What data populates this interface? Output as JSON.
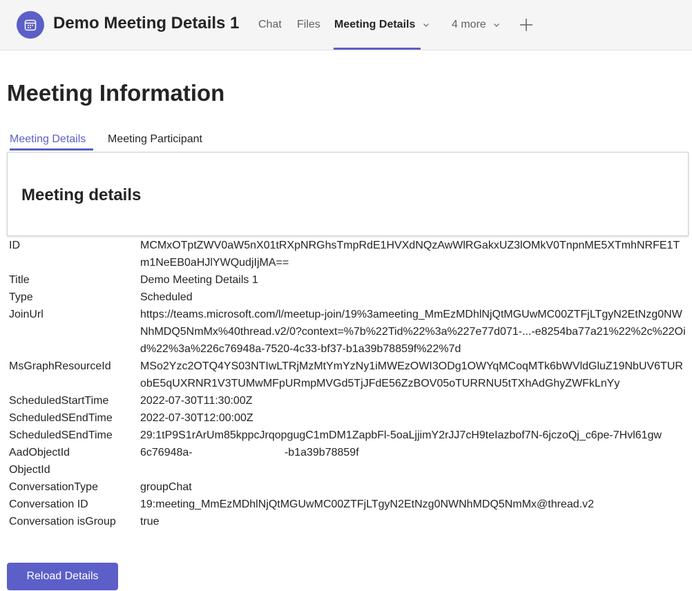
{
  "header": {
    "meeting_title": "Demo Meeting Details 1",
    "tabs": [
      {
        "label": "Chat"
      },
      {
        "label": "Files"
      },
      {
        "label": "Meeting Details"
      },
      {
        "label": "4 more"
      }
    ],
    "accent_color": "#5b5fc7"
  },
  "page": {
    "title": "Meeting Information",
    "subtabs": [
      {
        "label": "Meeting Details"
      },
      {
        "label": "Meeting Participant"
      }
    ],
    "card_title": "Meeting details"
  },
  "details": [
    {
      "label": "ID",
      "value": "MCMxOTptZWV0aW5nX01tRXpNRGhsTmpRdE1HVXdNQzAwWlRGakxUZ3lOMkV0TnpnME5XTmhNRFE1Tm1NeEB0aHJlYWQudjIjMA=="
    },
    {
      "label": "Title",
      "value": "Demo Meeting Details 1"
    },
    {
      "label": "Type",
      "value": "Scheduled"
    },
    {
      "label": "JoinUrl",
      "value": "https://teams.microsoft.com/l/meetup-join/19%3ameeting_MmEzMDhlNjQtMGUwMC00ZTFjLTgyN2EtNzg0NWNhMDQ5NmMx%40thread.v2/0?context=%7b%22Tid%22%3a%227e77d071-...-e8254ba77a21%22%2c%22Oid%22%3a%226c76948a-7520-4c33-bf37-b1a39b78859f%22%7d"
    },
    {
      "label": "MsGraphResourceId",
      "value": "MSo2Yzc2OTQ4YS03NTIwLTRjMzMtYmYzNy1iMWEzOWI3ODg1OWYqMCoqMTk6bWVldGluZ19NbUV6TURobE5qUXRNR1V3TUMwMFpURmpMVGd5TjJFdE56ZzBOV05oTURRNU5tTXhAdGhyZWFkLnYy"
    },
    {
      "label": "ScheduledStartTime",
      "value": "2022-07-30T11:30:00Z"
    },
    {
      "label": "ScheduledSEndTime",
      "value": "2022-07-30T12:00:00Z"
    },
    {
      "label": "ScheduledSEndTime",
      "value": "29:1tP9S1rArUm85kppcJrqopgugC1mDM1ZapbFl-5oaLjjimY2rJJ7cH9teIazbof7N-6jczoQj_c6pe-7Hvl61gw"
    },
    {
      "label": "AadObjectId",
      "value": "6c76948a-                              -b1a39b78859f"
    },
    {
      "label": "ObjectId",
      "value": ""
    },
    {
      "label": "ConversationType",
      "value": "groupChat"
    },
    {
      "label": "Conversation ID",
      "value": "19:meeting_MmEzMDhlNjQtMGUwMC00ZTFjLTgyN2EtNzg0NWNhMDQ5NmMx@thread.v2"
    },
    {
      "label": "Conversation isGroup",
      "value": "true"
    }
  ],
  "actions": {
    "reload_label": "Reload Details"
  }
}
